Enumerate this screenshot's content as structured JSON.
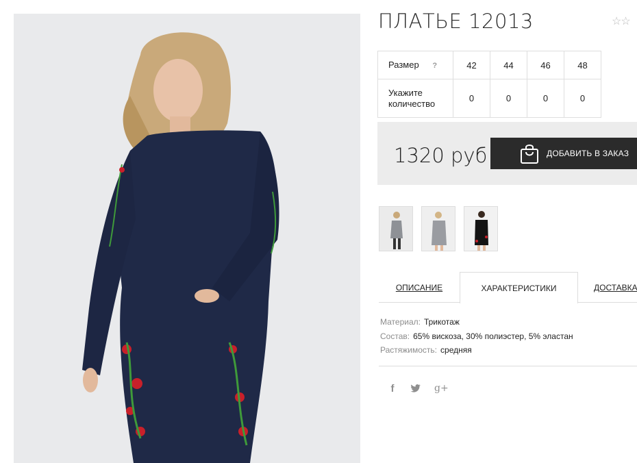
{
  "product": {
    "title": "ПЛАТЬЕ 12013",
    "rating_stars": "☆☆"
  },
  "size_table": {
    "size_label": "Размер",
    "help": "?",
    "sizes": [
      "42",
      "44",
      "46",
      "48"
    ],
    "qty_label": "Укажите количество",
    "quantities": [
      "0",
      "0",
      "0",
      "0"
    ]
  },
  "buy": {
    "price": "1320 руб",
    "add_label": "ДОБАВИТЬ В ЗАКАЗ"
  },
  "thumbnails": [
    "grey-dress-photo-1",
    "grey-dress-photo-2",
    "black-dress-photo"
  ],
  "tabs": {
    "description": "ОПИСАНИЕ",
    "characteristics": "ХАРАКТЕРИСТИКИ",
    "delivery": "ДОСТАВКА"
  },
  "specs": [
    {
      "key": "Материал:",
      "value": "Трикотаж"
    },
    {
      "key": "Состав:",
      "value": "65% вискоза, 30% полиэстер, 5% эластан"
    },
    {
      "key": "Растяжимость:",
      "value": "средняя"
    }
  ],
  "social": {
    "facebook": "f",
    "twitter": "twitter-icon",
    "googleplus": "g+"
  },
  "colors": {
    "dress": "#1f2947",
    "button": "#2b2b2b",
    "buy_box": "#ececec",
    "embroidery_red": "#c8202a",
    "embroidery_green": "#3f9a3a"
  }
}
